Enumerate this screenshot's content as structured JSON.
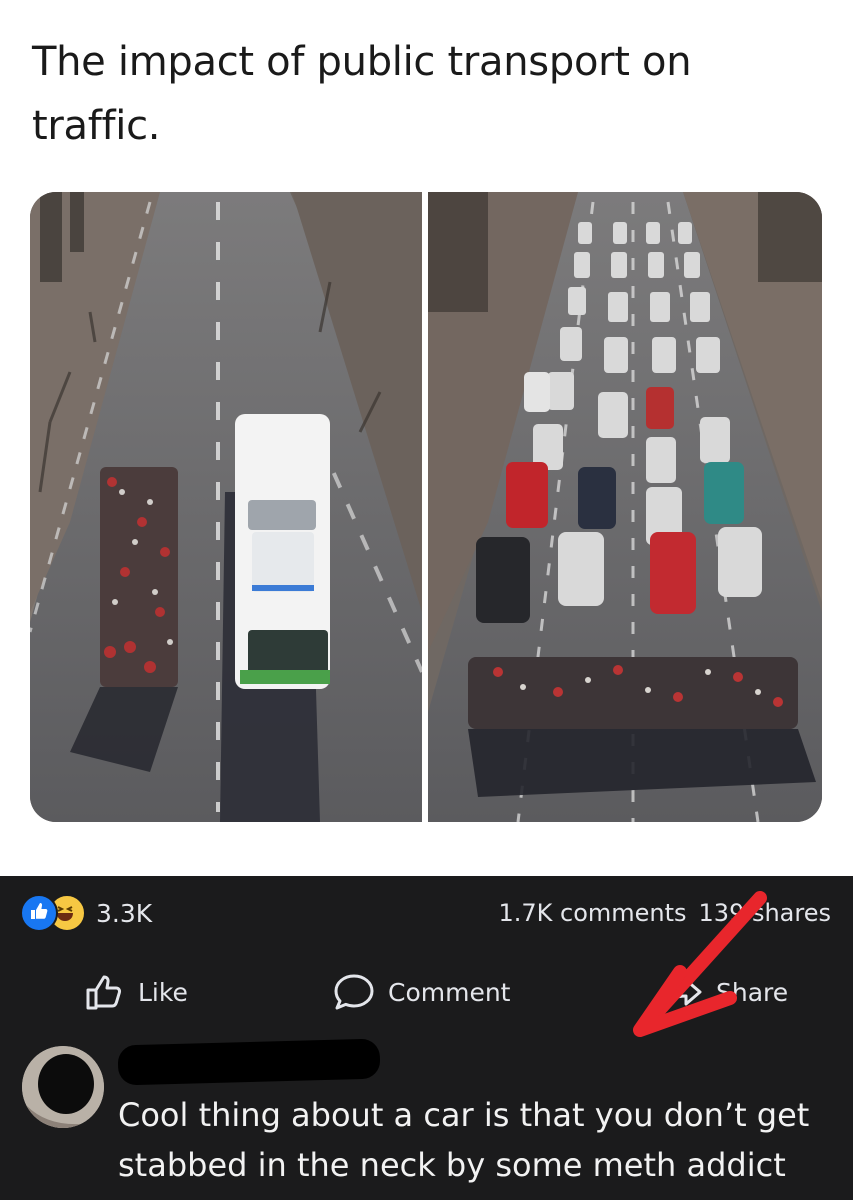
{
  "post": {
    "title": "The impact of public transport on traffic."
  },
  "footer": {
    "reactions": {
      "icons": [
        "like-icon",
        "haha-icon"
      ],
      "count": "3.3K"
    },
    "stats": {
      "comments": "1.7K comments",
      "shares": "139 shares"
    },
    "actions": {
      "like": "Like",
      "comment": "Comment",
      "share": "Share"
    }
  },
  "comment": {
    "text": "Cool thing about a car is that you don’t get stabbed in the neck by some meth addict"
  },
  "colors": {
    "background_top": "#ffffff",
    "background_bottom": "#1b1b1c",
    "like_blue": "#1877f2",
    "arrow_red": "#e8262c"
  }
}
